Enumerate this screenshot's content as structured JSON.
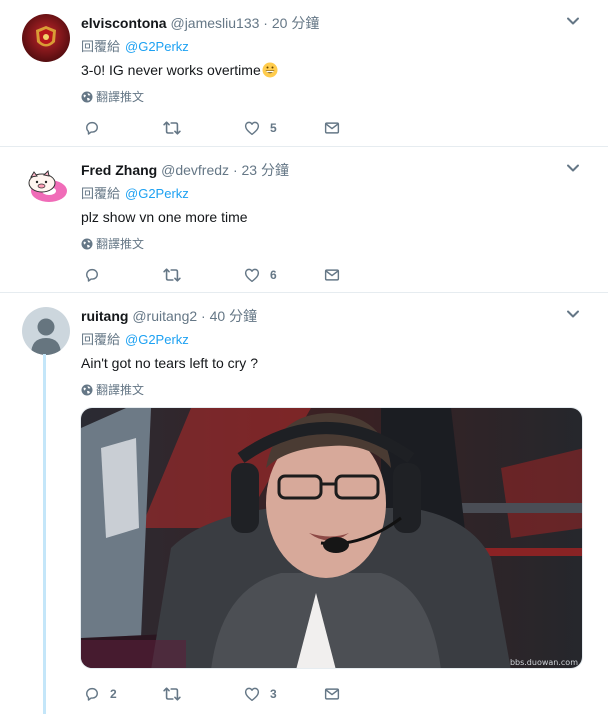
{
  "tweets": [
    {
      "name": "elviscontona",
      "handle": "@jamesliu133",
      "time": "20 分鐘",
      "reply_label": "回覆給",
      "reply_to": "@G2Perkz",
      "text": "3-0! IG never works overtime",
      "translate": "翻譯推文",
      "replies": "",
      "retweets": "",
      "likes": "5"
    },
    {
      "name": "Fred Zhang",
      "handle": "@devfredz",
      "time": "23 分鐘",
      "reply_label": "回覆給",
      "reply_to": "@G2Perkz",
      "text": "plz show vn one more time",
      "translate": "翻譯推文",
      "replies": "",
      "retweets": "",
      "likes": "6"
    },
    {
      "name": "ruitang",
      "handle": "@ruitang2",
      "time": "40 分鐘",
      "reply_label": "回覆給",
      "reply_to": "@G2Perkz",
      "text": "Ain't got no tears left to cry ?",
      "translate": "翻譯推文",
      "media_watermark": "bbs.duowan.com",
      "replies": "2",
      "retweets": "",
      "likes": "3"
    }
  ],
  "separator": "·",
  "colors": {
    "accent": "#1da1f2",
    "muted": "#657786",
    "thread": "#c4e6f9"
  }
}
